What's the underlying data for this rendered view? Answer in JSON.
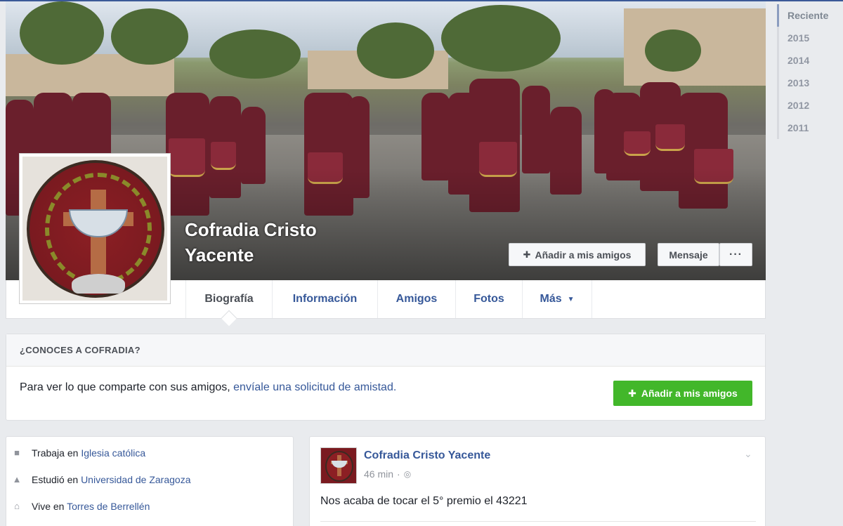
{
  "profile": {
    "name": "Cofradia Cristo Yacente"
  },
  "actions": {
    "add_friend_label": "Añadir a mis amigos",
    "message_label": "Mensaje",
    "more_label": "···"
  },
  "tabs": [
    {
      "label": "Biografía",
      "active": true
    },
    {
      "label": "Información"
    },
    {
      "label": "Amigos"
    },
    {
      "label": "Fotos"
    },
    {
      "label": "Más"
    }
  ],
  "years": [
    "Reciente",
    "2015",
    "2014",
    "2013",
    "2012",
    "2011"
  ],
  "know": {
    "heading": "¿CONOCES A COFRADIA?",
    "text": "Para ver lo que comparte con sus amigos,",
    "link": "envíale una solicitud de amistad.",
    "button_label": "Añadir a mis amigos"
  },
  "intro": [
    {
      "icon": "briefcase-icon",
      "prefix": "Trabaja en",
      "link": "Iglesia católica"
    },
    {
      "icon": "graduation-cap-icon",
      "prefix": "Estudió en",
      "link": "Universidad de Zaragoza"
    },
    {
      "icon": "home-icon",
      "prefix": "Vive en",
      "link": "Torres de Berrellén"
    }
  ],
  "post": {
    "author": "Cofradia Cristo Yacente",
    "time": "46 min",
    "separator": "·",
    "text": "Nos acaba de tocar el 5° premio el 43221"
  },
  "colors": {
    "link": "#365899",
    "green_button": "#42b72a",
    "page_bg": "#e9ebee"
  }
}
